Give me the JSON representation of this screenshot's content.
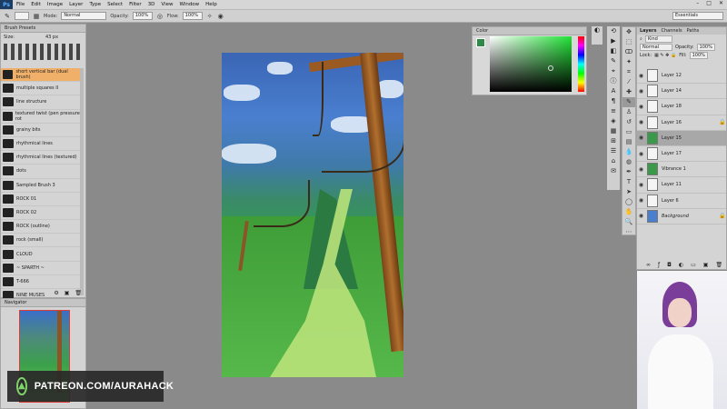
{
  "app": {
    "logo": "Ps"
  },
  "menu": [
    "File",
    "Edit",
    "Image",
    "Layer",
    "Type",
    "Select",
    "Filter",
    "3D",
    "View",
    "Window",
    "Help"
  ],
  "window_controls": [
    "–",
    "□",
    "✕"
  ],
  "options": {
    "mode_label": "Mode:",
    "mode_value": "Normal",
    "opacity_label": "Opacity:",
    "opacity_value": "100%",
    "flow_label": "Flow:",
    "flow_value": "100%",
    "workspace": "Essentials"
  },
  "brush_panel": {
    "tab": "Brush Presets",
    "size_label": "Size:",
    "size_value": "43 px",
    "items": [
      "short vertical bar (dual brush)",
      "multiple squares II",
      "line structure",
      "textured twist (pen pressure rot",
      "grainy bits",
      "rhythmical lines",
      "rhythmical lines (textured)",
      "dots",
      "Sampled Brush 3",
      "ROCK 01",
      "ROCK 02",
      "ROCK (outline)",
      "rock (small)",
      "CLOUD",
      "~ SPARTH ~",
      "T-666",
      "NINE MUSES"
    ],
    "selected_index": 0
  },
  "navigator": {
    "tab": "Navigator"
  },
  "color_panel": {
    "tab": "Color",
    "foreground": "#2f8a4a"
  },
  "layers_panel": {
    "tabs": [
      "Layers",
      "Channels",
      "Paths"
    ],
    "kind_label": "Kind",
    "blend_mode": "Normal",
    "opacity_label": "Opacity:",
    "opacity_value": "100%",
    "lock_label": "Lock:",
    "fill_label": "Fill:",
    "fill_value": "100%",
    "layers": [
      "Layer 12",
      "Layer 14",
      "Layer 18",
      "Layer 16",
      "Layer 15",
      "Layer 17",
      "Vibrance 1",
      "Layer 11",
      "Layer 6",
      "Background"
    ],
    "selected_index": 4
  },
  "watermark": {
    "text": "PATREON.COM/AURAHACK"
  }
}
